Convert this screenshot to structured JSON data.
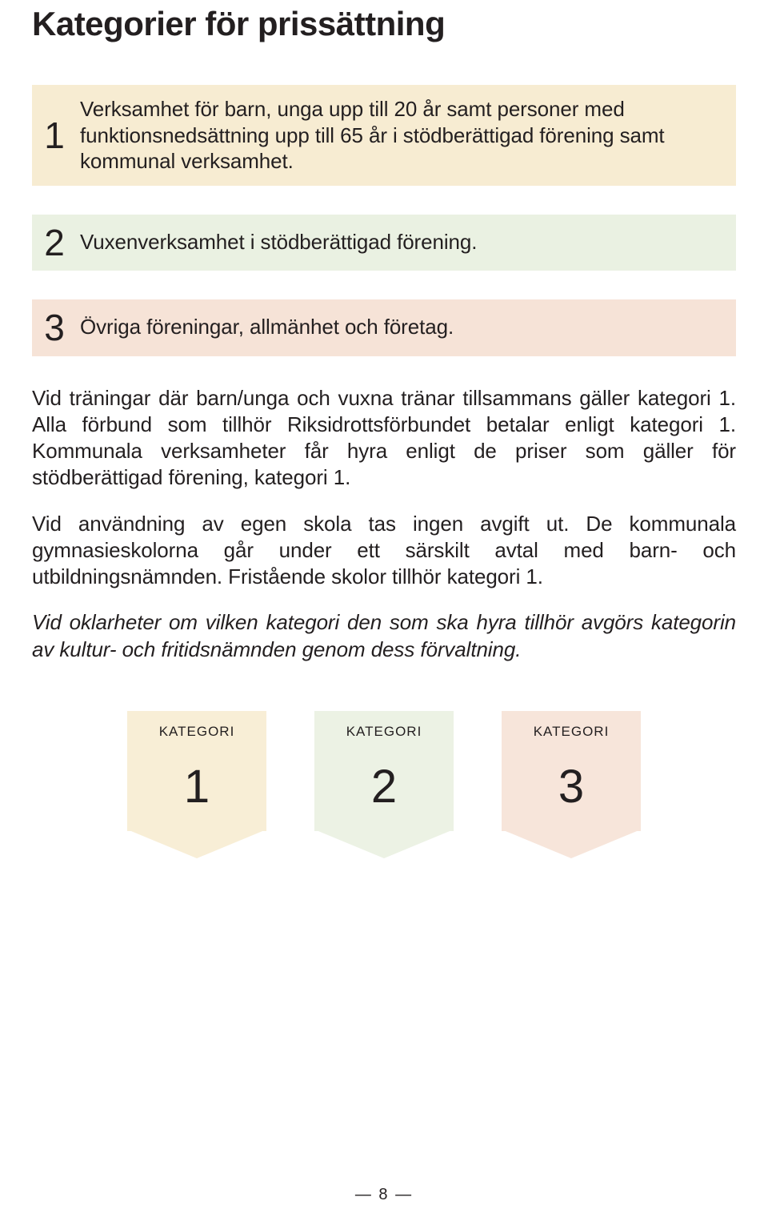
{
  "title": "Kategorier för prissättning",
  "categories": [
    {
      "num": "1",
      "text": "Verksamhet för barn, unga upp till 20 år samt personer med funktionsnedsättning upp till 65 år i stödberättigad förening samt kommunal verksamhet.",
      "bg": "bg-cream",
      "single": false
    },
    {
      "num": "2",
      "text": "Vuxenverksamhet i stödberättigad förening.",
      "bg": "bg-green",
      "single": true
    },
    {
      "num": "3",
      "text": "Övriga föreningar, allmänhet och företag.",
      "bg": "bg-peach",
      "single": true
    }
  ],
  "paragraphs": {
    "p1": "Vid träningar där barn/unga och vuxna tränar tillsammans gäller kategori 1. Alla förbund som tillhör Riksidrottsförbundet betalar enligt kategori 1. Kommunala verksamheter får hyra enligt de priser som gäller för stödberättigad förening, kategori 1.",
    "p2": "Vid användning av egen skola tas ingen avgift ut. De kommunala gymnasieskolorna går under ett särskilt avtal med barn- och utbildningsnämnden. Fristående skolor tillhör kategori 1.",
    "p3": "Vid oklarheter om vilken kategori den som ska hyra tillhör avgörs kategorin av kultur- och fritidsnämnden genom dess förvaltning."
  },
  "pennant_label": "KATEGORI",
  "pennants": [
    {
      "num": "1",
      "cls": "p-cream"
    },
    {
      "num": "2",
      "cls": "p-green"
    },
    {
      "num": "3",
      "cls": "p-peach"
    }
  ],
  "page_number": "—  8  —"
}
